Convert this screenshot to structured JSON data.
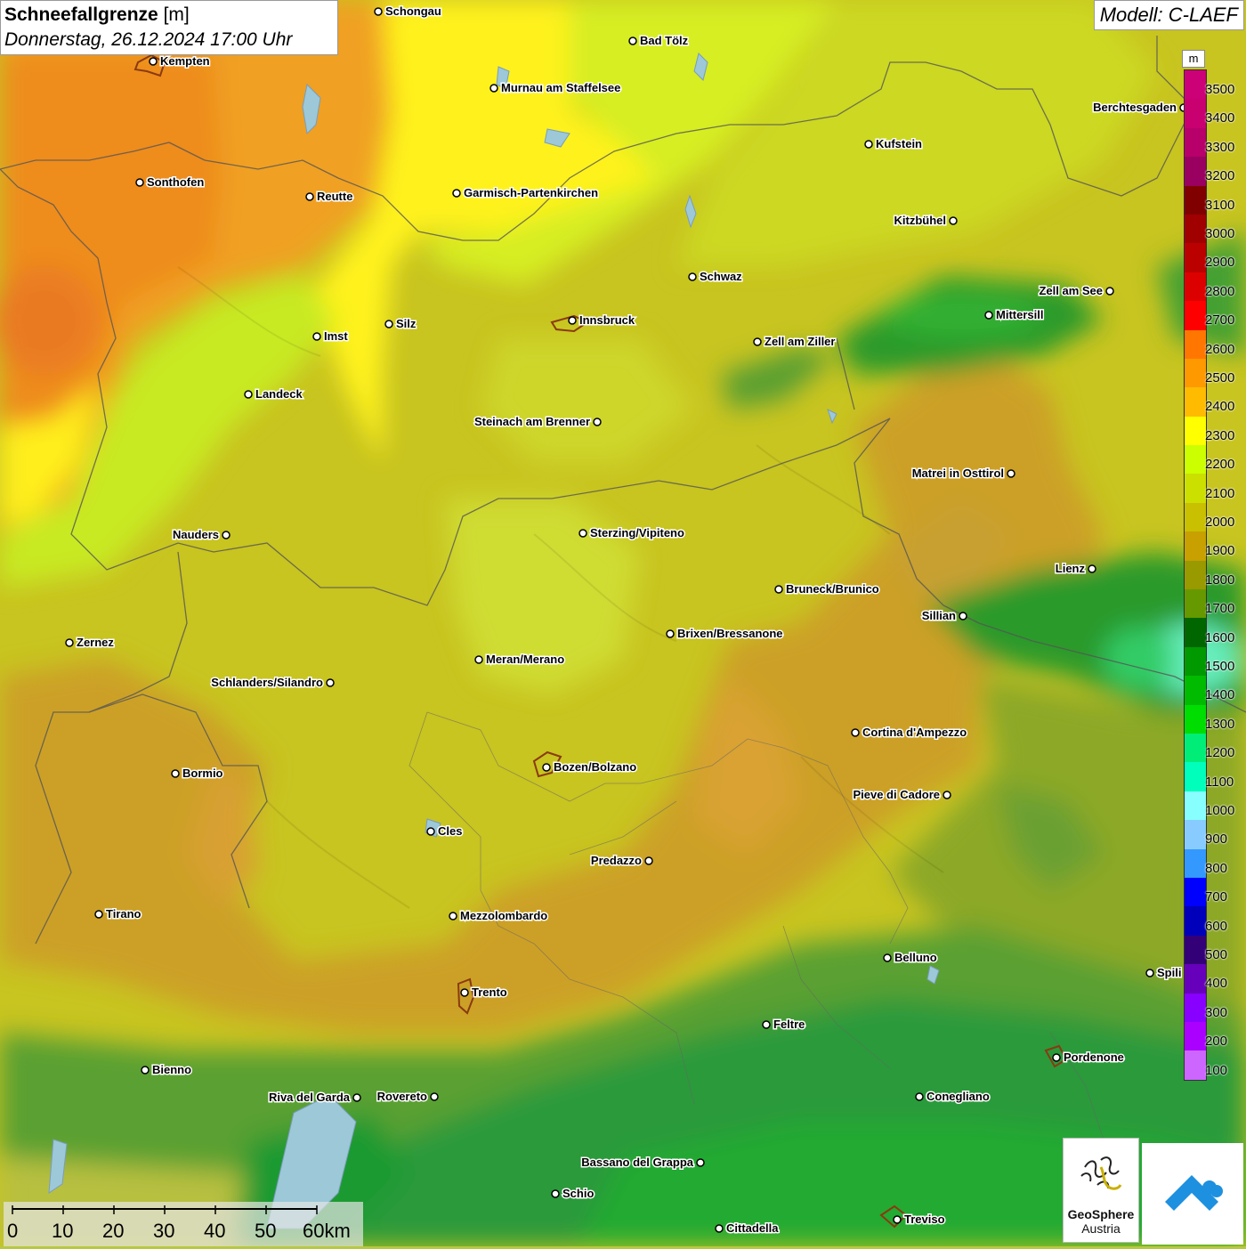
{
  "title": {
    "main": "Schneefallgrenze",
    "unit": "[m]",
    "datetime": "Donnerstag, 26.12.2024 17:00 Uhr"
  },
  "model": "Modell: C-LAEF",
  "legend": {
    "unit": "m",
    "levels": [
      {
        "label": "3500",
        "color": "#cc0077"
      },
      {
        "label": "3400",
        "color": "#c80070"
      },
      {
        "label": "3300",
        "color": "#b8006a"
      },
      {
        "label": "3200",
        "color": "#9a0060"
      },
      {
        "label": "3100",
        "color": "#800000"
      },
      {
        "label": "3000",
        "color": "#a00000"
      },
      {
        "label": "2900",
        "color": "#bb0000"
      },
      {
        "label": "2800",
        "color": "#dd0000"
      },
      {
        "label": "2700",
        "color": "#ff0000"
      },
      {
        "label": "2600",
        "color": "#ff7700"
      },
      {
        "label": "2500",
        "color": "#ff9900"
      },
      {
        "label": "2400",
        "color": "#ffbb00"
      },
      {
        "label": "2300",
        "color": "#ffff00"
      },
      {
        "label": "2200",
        "color": "#ccff00"
      },
      {
        "label": "2100",
        "color": "#cce000"
      },
      {
        "label": "2000",
        "color": "#c8c000"
      },
      {
        "label": "1900",
        "color": "#c8a000"
      },
      {
        "label": "1800",
        "color": "#999900"
      },
      {
        "label": "1700",
        "color": "#669900"
      },
      {
        "label": "1600",
        "color": "#006600"
      },
      {
        "label": "1500",
        "color": "#009900"
      },
      {
        "label": "1400",
        "color": "#00bb00"
      },
      {
        "label": "1300",
        "color": "#00dd00"
      },
      {
        "label": "1200",
        "color": "#00ee77"
      },
      {
        "label": "1100",
        "color": "#00ffbb"
      },
      {
        "label": "1000",
        "color": "#88ffff"
      },
      {
        "label": "900",
        "color": "#88ccff"
      },
      {
        "label": "800",
        "color": "#3399ff"
      },
      {
        "label": "700",
        "color": "#0000ff"
      },
      {
        "label": "600",
        "color": "#0000bb"
      },
      {
        "label": "500",
        "color": "#330077"
      },
      {
        "label": "400",
        "color": "#6600bb"
      },
      {
        "label": "300",
        "color": "#8800ff"
      },
      {
        "label": "200",
        "color": "#aa00ff"
      },
      {
        "label": "100",
        "color": "#cc66ff"
      }
    ]
  },
  "cities": [
    {
      "name": "Schongau"
    },
    {
      "name": "Kempten"
    },
    {
      "name": "Bad Tölz"
    },
    {
      "name": "Murnau am Staffelsee"
    },
    {
      "name": "Berchtesgaden"
    },
    {
      "name": "Kufstein"
    },
    {
      "name": "Sonthofen"
    },
    {
      "name": "Reutte"
    },
    {
      "name": "Garmisch-Partenkirchen"
    },
    {
      "name": "Kitzbühel"
    },
    {
      "name": "Schwaz"
    },
    {
      "name": "Zell am See"
    },
    {
      "name": "Innsbruck"
    },
    {
      "name": "Mittersill"
    },
    {
      "name": "Silz"
    },
    {
      "name": "Imst"
    },
    {
      "name": "Zell am Ziller"
    },
    {
      "name": "Landeck"
    },
    {
      "name": "Steinach am Brenner"
    },
    {
      "name": "Matrei in Osttirol"
    },
    {
      "name": "Nauders"
    },
    {
      "name": "Sterzing/Vipiteno"
    },
    {
      "name": "Lienz"
    },
    {
      "name": "Bruneck/Brunico"
    },
    {
      "name": "Sillian"
    },
    {
      "name": "Brixen/Bressanone"
    },
    {
      "name": "Zernez"
    },
    {
      "name": "Meran/Merano"
    },
    {
      "name": "Schlanders/Silandro"
    },
    {
      "name": "Cortina d'Ampezzo"
    },
    {
      "name": "Bozen/Bolzano"
    },
    {
      "name": "Bormio"
    },
    {
      "name": "Pieve di Cadore"
    },
    {
      "name": "Cles"
    },
    {
      "name": "Predazzo"
    },
    {
      "name": "Tirano"
    },
    {
      "name": "Mezzolombardo"
    },
    {
      "name": "Belluno"
    },
    {
      "name": "Spili"
    },
    {
      "name": "Trento"
    },
    {
      "name": "Feltre"
    },
    {
      "name": "Pordenone"
    },
    {
      "name": "Bienno"
    },
    {
      "name": "Riva del Garda"
    },
    {
      "name": "Rovereto"
    },
    {
      "name": "Conegliano"
    },
    {
      "name": "Bassano del Grappa"
    },
    {
      "name": "Schio"
    },
    {
      "name": "Treviso"
    },
    {
      "name": "Cittadella"
    }
  ],
  "scalebar": {
    "labels": [
      "0",
      "10",
      "20",
      "30",
      "40",
      "50",
      "60km"
    ]
  },
  "logos": {
    "geosphere_line1": "GeoSphere",
    "geosphere_line2": "Austria"
  }
}
